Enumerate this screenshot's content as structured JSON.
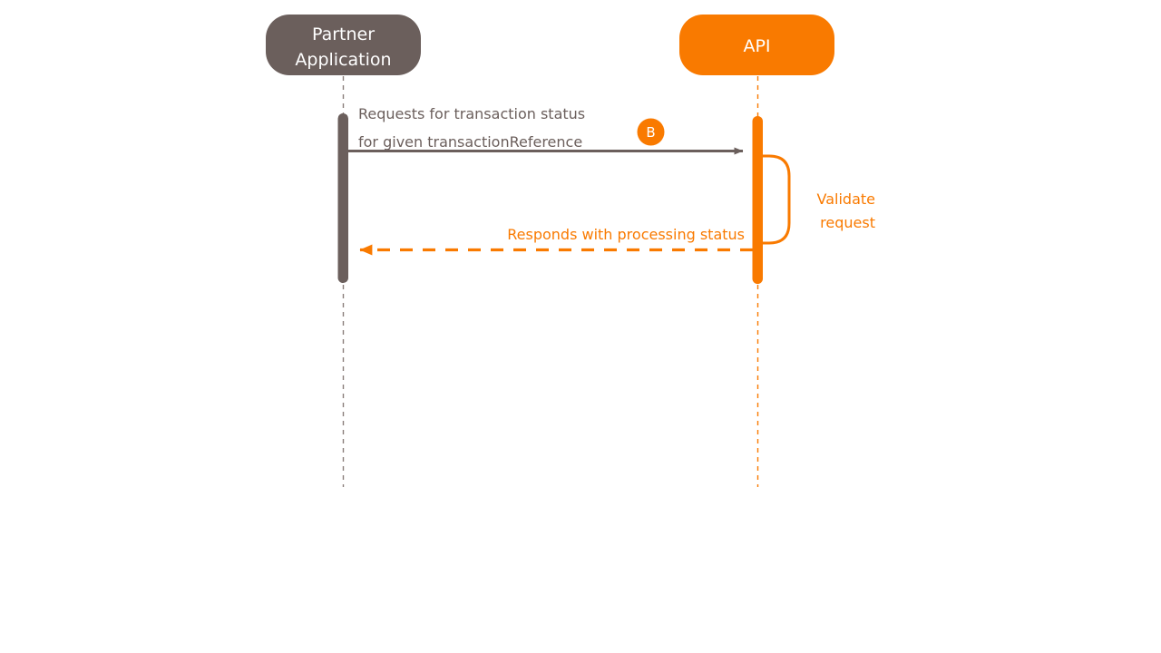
{
  "diagram": {
    "type": "sequence-diagram",
    "title": "",
    "background_color": "#FFFFFF",
    "colors": {
      "actor_dark": "#6B5F5C",
      "actor_orange": "#F97A00",
      "text_on_fill": "#FFFFFF",
      "label_dark": "#6B5F5C",
      "label_orange": "#F97A00"
    },
    "participants": [
      {
        "id": "partner",
        "name_lines": [
          "Partner",
          "Application"
        ],
        "line1": "Partner",
        "line2": "Application",
        "fill": "#6B5F5C",
        "text_color": "#FFFFFF",
        "lifeline_color": "#6B5F5C",
        "lifeline_style": "dashed"
      },
      {
        "id": "api",
        "name_lines": [
          "API"
        ],
        "line1": "API",
        "line2": "",
        "fill": "#F97A00",
        "text_color": "#FFFFFF",
        "lifeline_color": "#F97A00",
        "lifeline_style": "dashed"
      }
    ],
    "badges": [
      {
        "id": "badge-b",
        "label": "B",
        "fill": "#F97A00",
        "text_color": "#FFFFFF"
      }
    ],
    "messages": [
      {
        "id": "msg-request",
        "from": "partner",
        "to": "api",
        "direction": "right",
        "style": "solid",
        "color": "#6B5F5C",
        "label_lines": [
          "Requests for transaction status",
          "for given transactionReference"
        ],
        "label_line1": "Requests for transaction status",
        "label_line2": "for given transactionReference"
      },
      {
        "id": "msg-self-validate",
        "from": "api",
        "to": "api",
        "direction": "self",
        "style": "solid",
        "color": "#F97A00",
        "label_lines": [
          "Validate",
          "request"
        ],
        "label_line1": "Validate",
        "label_line2": "request"
      },
      {
        "id": "msg-response",
        "from": "api",
        "to": "partner",
        "direction": "left",
        "style": "dashed",
        "color": "#F97A00",
        "label_lines": [
          "Responds with processing status"
        ],
        "label_line1": "Responds with processing status",
        "label_line2": ""
      }
    ],
    "activations": [
      {
        "id": "activation-partner",
        "participant": "partner",
        "color": "#6B5F5C"
      },
      {
        "id": "activation-api",
        "participant": "api",
        "color": "#F97A00"
      }
    ]
  }
}
